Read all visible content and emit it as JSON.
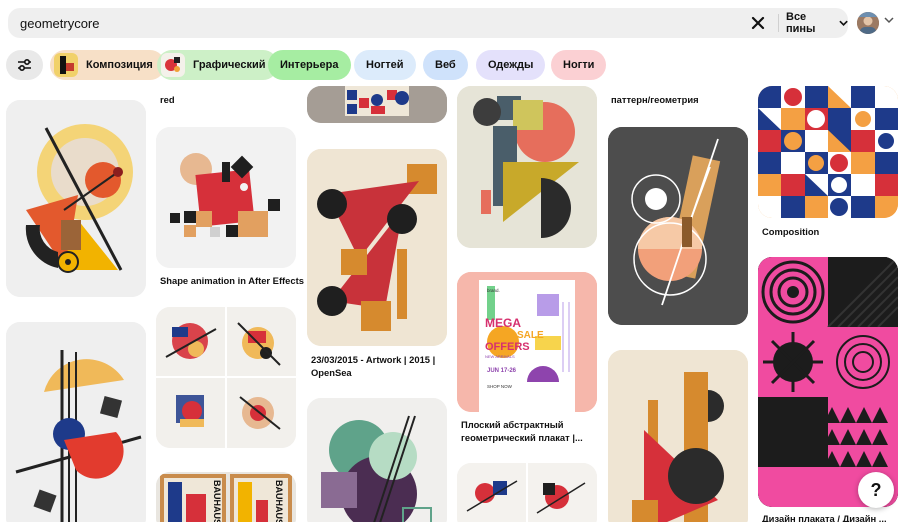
{
  "search": {
    "query": "geometrycore",
    "filter_label": "Все пины"
  },
  "chips": [
    {
      "label": "Композиция",
      "bg": "#f7e0c7"
    },
    {
      "label": "Графический",
      "bg": "#cdf0c7"
    },
    {
      "label": "Интерьера",
      "bg": "#a6eda2"
    },
    {
      "label": "Ногтей",
      "bg": "#dcebfb"
    },
    {
      "label": "Веб",
      "bg": "#cfe2fb"
    },
    {
      "label": "Одежды",
      "bg": "#e4e1fb"
    },
    {
      "label": "Ногти",
      "bg": "#fbd0d3"
    }
  ],
  "captions": {
    "col1_top": "red",
    "col1_pin2": "Shape animation in After Effects",
    "col2_pin2": "23/03/2015 - Artwork | 2015 | OpenSea",
    "col3_top": "паттерн/геометрия",
    "col3_pin2": "Плоский абстрактный геометрический плакат |...",
    "col5_pin1": "Composition",
    "col5_pin2": "Дизайн плаката / Дизайн ..."
  },
  "poster": {
    "brand": "brand.",
    "line1": "MEGA",
    "line2": "SALE",
    "line3": "OFFERS",
    "sub": "NEW ARRIVALS",
    "date": "JUN 17-26",
    "shop": "SHOP NOW"
  },
  "bauhaus_text": "BAUHAUS",
  "help_label": "?",
  "colors": {
    "accent": "#e60023",
    "pink": "#f04ba0",
    "orange": "#e8893a",
    "navy": "#1e3a8a"
  }
}
